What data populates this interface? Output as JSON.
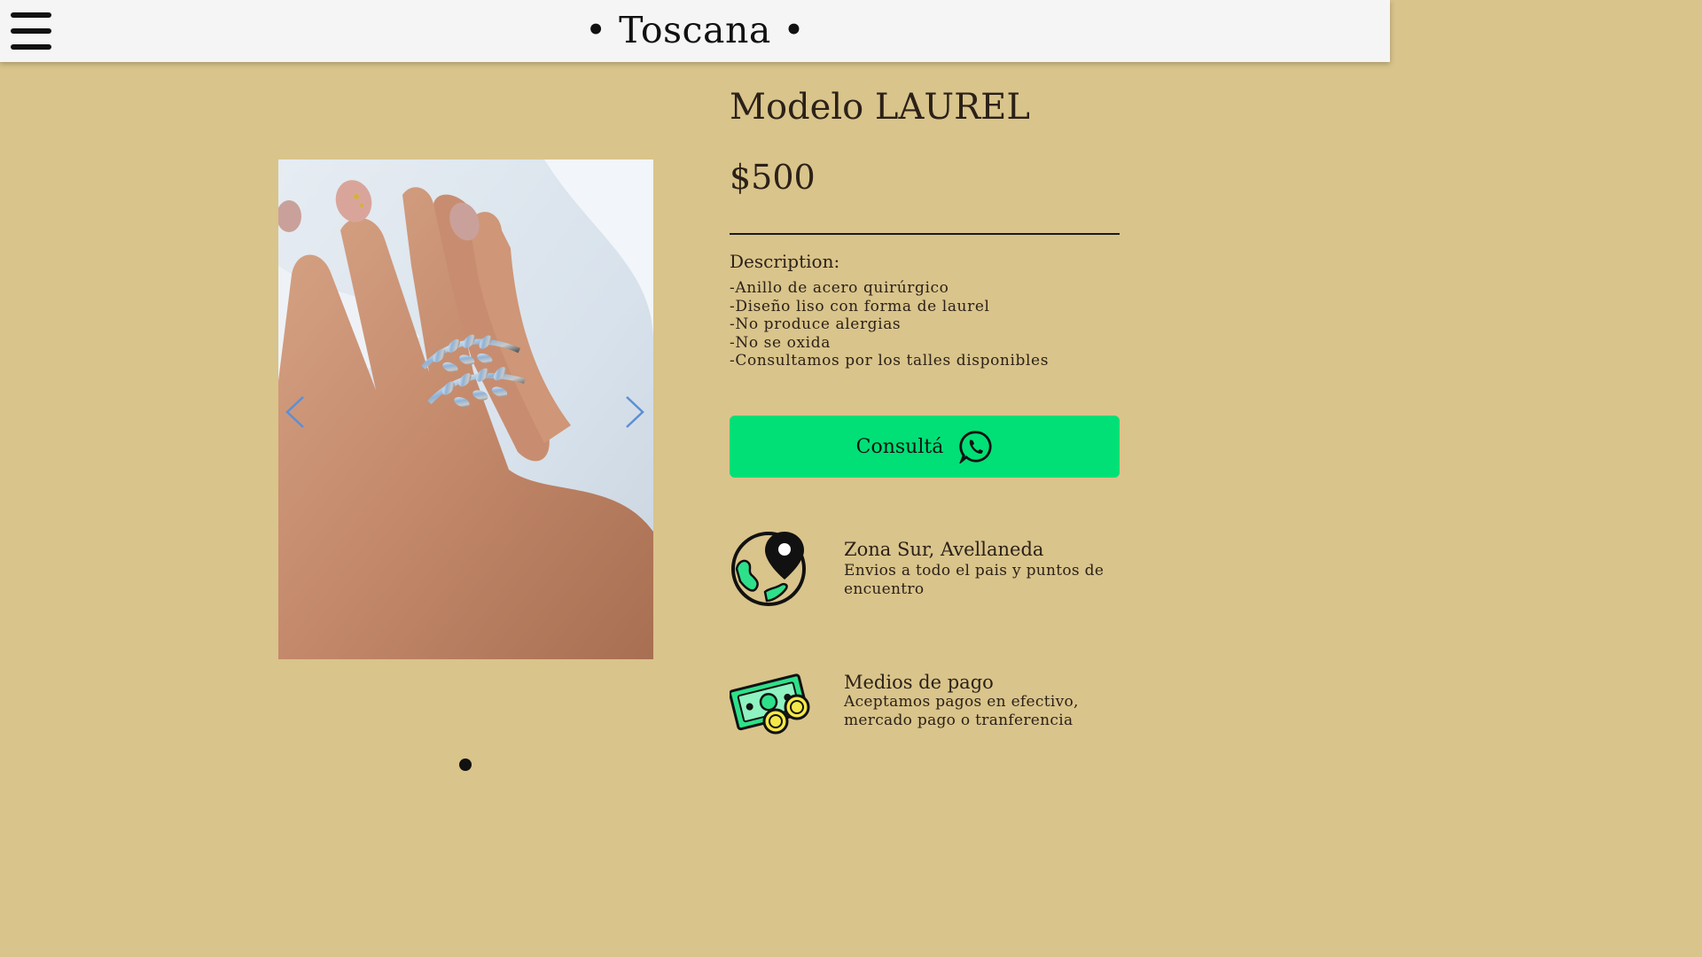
{
  "header": {
    "brand": "• Toscana •",
    "menu_icon": "hamburger-menu-icon"
  },
  "product": {
    "title": "Modelo LAUREL",
    "price": "$500",
    "description_label": "Description:",
    "description_lines": [
      "-Anillo de acero quirúrgico",
      "-Diseño liso con forma de laurel",
      "-No produce alergias",
      "-No se oxida",
      "-Consultamos por los talles disponibles"
    ],
    "cta_label": "Consultá",
    "cta_icon": "whatsapp-icon"
  },
  "carousel": {
    "prev_icon": "chevron-left-icon",
    "next_icon": "chevron-right-icon",
    "slide_count": 1,
    "active_index": 0
  },
  "info": [
    {
      "icon": "globe-location-icon",
      "title": "Zona Sur, Avellaneda",
      "text": "Envios a todo el pais y puntos de encuentro"
    },
    {
      "icon": "money-payment-icon",
      "title": "Medios de pago",
      "text": "Aceptamos pagos en efectivo, mercado pago o tranferencia"
    }
  ],
  "colors": {
    "background": "#d9c48b",
    "header": "#f5f5f5",
    "cta": "#00e076",
    "text": "#2b2118"
  }
}
